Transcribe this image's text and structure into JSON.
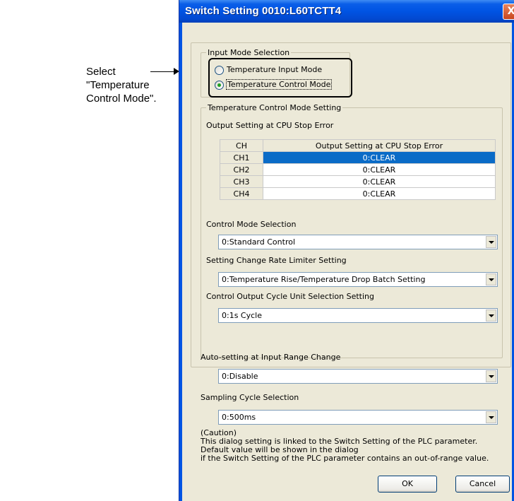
{
  "annotation": {
    "text": "Select \"Temperature Control Mode\"."
  },
  "window": {
    "title": "Switch Setting 0010:L60TCTT4",
    "close_label": "X"
  },
  "input_mode": {
    "legend": "Input Mode Selection",
    "options": [
      {
        "label": "Temperature Input Mode",
        "selected": false
      },
      {
        "label": "Temperature Control Mode",
        "selected": true
      }
    ]
  },
  "tc_group": {
    "legend": "Temperature Control Mode Setting",
    "output_setting_label": "Output Setting at CPU Stop Error",
    "table": {
      "headers": [
        "CH",
        "Output Setting at CPU Stop Error"
      ],
      "rows": [
        {
          "ch": "CH1",
          "value": "0:CLEAR",
          "selected": true
        },
        {
          "ch": "CH2",
          "value": "0:CLEAR",
          "selected": false
        },
        {
          "ch": "CH3",
          "value": "0:CLEAR",
          "selected": false
        },
        {
          "ch": "CH4",
          "value": "0:CLEAR",
          "selected": false
        }
      ]
    },
    "control_mode": {
      "label": "Control Mode Selection",
      "value": "0:Standard Control"
    },
    "rate_limiter": {
      "label": "Setting Change Rate Limiter Setting",
      "value": "0:Temperature Rise/Temperature Drop Batch Setting"
    },
    "cycle_unit": {
      "label": "Control Output Cycle Unit Selection Setting",
      "value": "0:1s Cycle"
    }
  },
  "auto_setting": {
    "label": "Auto-setting at Input Range Change",
    "value": "0:Disable"
  },
  "sampling": {
    "label": "Sampling Cycle Selection",
    "value": "0:500ms"
  },
  "caution": {
    "lines": [
      "(Caution)",
      "This dialog setting is linked to the Switch Setting of the PLC parameter.",
      "Default value will be shown in the dialog",
      "if the Switch Setting of the PLC parameter contains an out-of-range value."
    ]
  },
  "buttons": {
    "ok": "OK",
    "cancel": "Cancel"
  }
}
